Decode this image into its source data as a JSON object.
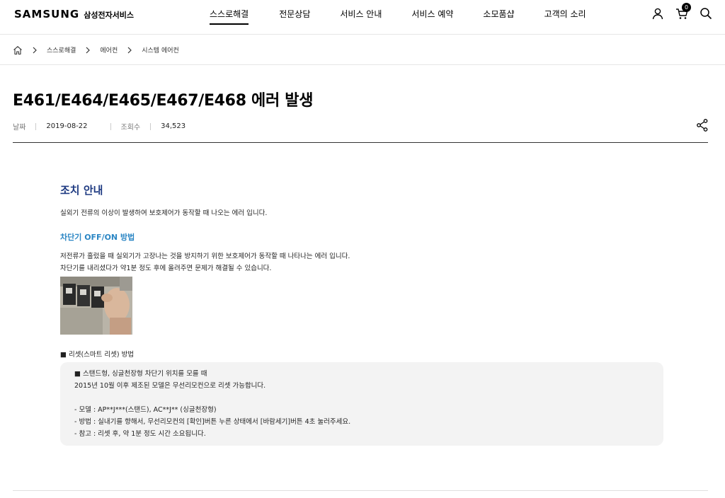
{
  "header": {
    "brand": "SAMSUNG",
    "brand_sub": "삼성전자서비스",
    "nav": [
      "스스로해결",
      "전문상담",
      "서비스 안내",
      "서비스 예약",
      "소모품샵",
      "고객의 소리"
    ],
    "cart_count": "0"
  },
  "breadcrumb": {
    "items": [
      "스스로해결",
      "에어컨",
      "시스템 에어컨"
    ]
  },
  "article": {
    "title": "E461/E464/E465/E467/E468 에러 발생",
    "date_label": "날짜",
    "date": "2019-08-22",
    "views_label": "조회수",
    "views": "34,523"
  },
  "content": {
    "section_title": "조치 안내",
    "intro": "실외기 전류의 이상이 발생하여 보호제어가 동작할 때 나오는 에러 입니다.",
    "breaker_title": "차단기 OFF/ON 방법",
    "breaker_lines": [
      "저전류가 흘렀을 때 실외기가 고장나는 것을 방지하기 위한 보호제어가 동작할 때 나타나는 에러 입니다.",
      "차단기를 내리셨다가 약1분 정도 후에 올려주면 문제가 해결될 수 있습니다."
    ],
    "reset_title": "■ 리셋(스마트 리셋) 방법",
    "reset_box": {
      "heading": "■ 스탠드형, 싱글천장형 차단기 위치를 모를 때",
      "line1": "2015년 10월 이후 제조된 모델은 무선리모컨으로 리셋 가능합니다.",
      "items": [
        "- 모델 : AP**J***(스탠드), AC**J** (싱글천장형)",
        "- 방법 : 실내기를 향해서, 무선리모컨의 [확인]버튼 누른 상태에서 [바람세기]버튼 4초 눌러주세요.",
        "- 참고 : 리셋 후, 약 1분 정도 시간 소요됩니다."
      ]
    }
  },
  "colors": {
    "section_title": "#1f3b82",
    "sub_title": "#2b86c4",
    "box_bg": "#f3f3f3"
  }
}
